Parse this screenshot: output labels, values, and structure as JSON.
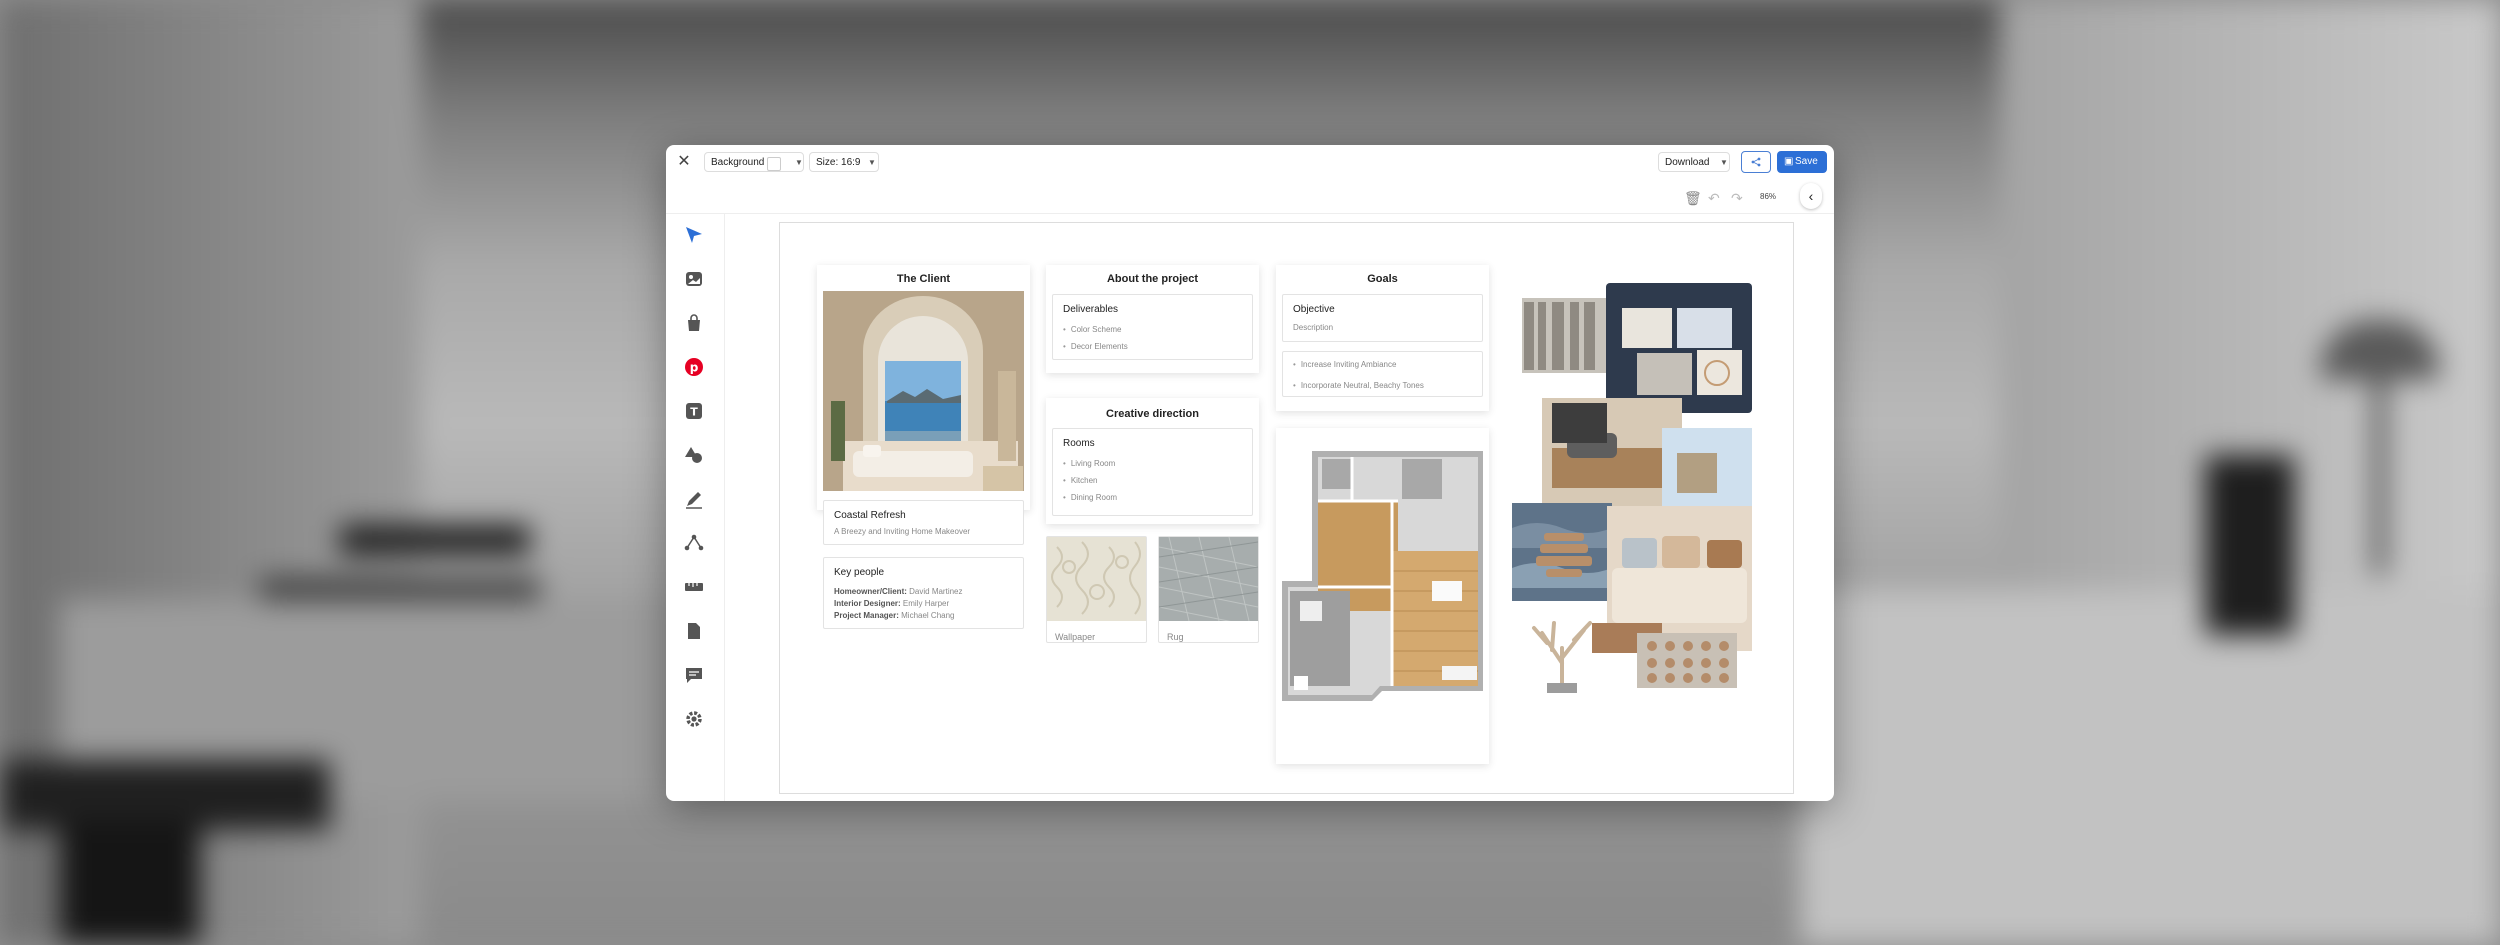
{
  "toolbar": {
    "background_label": "Background",
    "size_label": "Size: 16:9",
    "download_label": "Download",
    "save_label": "Save",
    "zoom": "86%"
  },
  "board": {
    "client": {
      "heading": "The Client",
      "project_title": "Coastal Refresh",
      "project_subtitle": "A Breezy and Inviting Home Makeover",
      "key_people_title": "Key people",
      "people": [
        {
          "role": "Homeowner/Client:",
          "name": "David Martinez"
        },
        {
          "role": "Interior Designer:",
          "name": "Emily Harper"
        },
        {
          "role": "Project Manager:",
          "name": "Michael Chang"
        }
      ]
    },
    "about": {
      "heading": "About the project",
      "deliverables_title": "Deliverables",
      "deliverables": [
        "Color Scheme",
        "Decor Elements"
      ]
    },
    "creative": {
      "heading": "Creative direction",
      "rooms_title": "Rooms",
      "rooms": [
        "Living Room",
        "Kitchen",
        "Dining Room"
      ],
      "swatches": [
        "Wallpaper",
        "Rug"
      ]
    },
    "goals": {
      "heading": "Goals",
      "objective_title": "Objective",
      "objective_desc": "Description",
      "items": [
        "Increase Inviting Ambiance",
        "Incorporate Neutral, Beachy Tones"
      ]
    }
  },
  "colors": {
    "accent": "#2c6fd6",
    "pinterest": "#e60023"
  }
}
